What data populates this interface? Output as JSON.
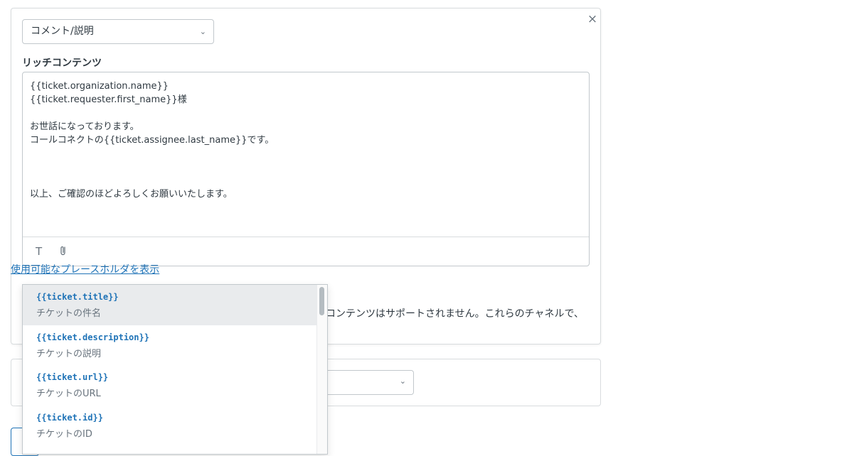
{
  "action_card": {
    "close_glyph": "×",
    "type_select": {
      "value": "コメント/説明",
      "chevron": "⌄"
    },
    "rich_content_label": "リッチコンテンツ",
    "editor_lines": [
      "{{ticket.organization.name}}",
      "{{ticket.requester.first_name}}様",
      "",
      "お世話になっております。",
      "コールコネクトの{{ticket.assignee.last_name}}です。",
      "",
      "",
      "",
      "以上、ご確認のほどよろしくお願いいたします。"
    ],
    "toolbar": {
      "text_icon": "T",
      "attach_icon": "📎"
    },
    "placeholder_link": "使用可能なプレースホルダを表示",
    "partial_note": "コンテンツはサポートされません。これらのチャネルで、"
  },
  "second_card": {
    "select_chevron": "⌄"
  },
  "placeholder_dropdown": {
    "items": [
      {
        "code": "{{ticket.title}}",
        "desc": "チケットの件名",
        "active": true
      },
      {
        "code": "{{ticket.description}}",
        "desc": "チケットの説明",
        "active": false
      },
      {
        "code": "{{ticket.url}}",
        "desc": "チケットのURL",
        "active": false
      },
      {
        "code": "{{ticket.id}}",
        "desc": "チケットのID",
        "active": false
      }
    ]
  }
}
